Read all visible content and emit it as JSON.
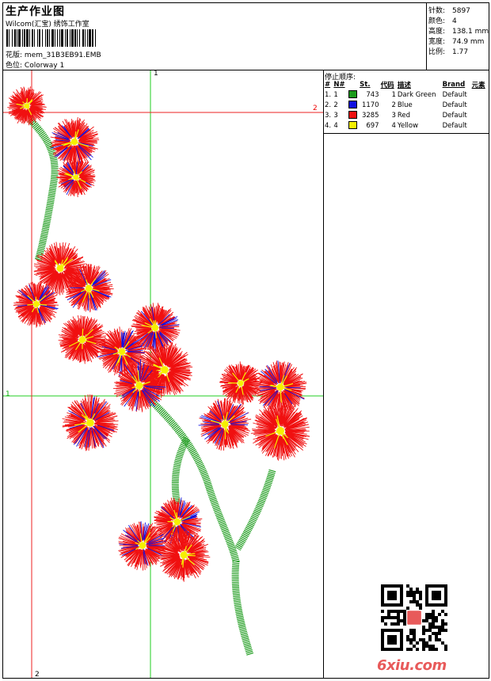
{
  "header": {
    "title": "生产作业图",
    "company": "Wilcom(汇宝) 绣饰工作室",
    "pattern_label": "花版:",
    "pattern_value": "mem_31B3EB91.EMB",
    "colorway_label": "色位:",
    "colorway_value": "Colorway 1"
  },
  "stats": [
    {
      "label": "针数:",
      "value": "5897"
    },
    {
      "label": "颜色:",
      "value": "4"
    },
    {
      "label": "高度:",
      "value": "138.1 mm"
    },
    {
      "label": "宽度:",
      "value": "74.9 mm"
    },
    {
      "label": "比例:",
      "value": "1.77"
    }
  ],
  "stop_sequence": {
    "title": "停止顺序:",
    "columns": [
      "#",
      "N#",
      "St.",
      "代码",
      "描述",
      "Brand",
      "元素"
    ],
    "rows": [
      {
        "idx": "1.",
        "n": "1",
        "color": "#1a9a1a",
        "st": "743",
        "code": "1",
        "desc": "Dark Green",
        "brand": "Default",
        "el": ""
      },
      {
        "idx": "2.",
        "n": "2",
        "color": "#1010e0",
        "st": "1170",
        "code": "2",
        "desc": "Blue",
        "brand": "Default",
        "el": ""
      },
      {
        "idx": "3.",
        "n": "3",
        "color": "#f01010",
        "st": "3285",
        "code": "3",
        "desc": "Red",
        "brand": "Default",
        "el": ""
      },
      {
        "idx": "4.",
        "n": "4",
        "color": "#f5f000",
        "st": "697",
        "code": "4",
        "desc": "Yellow",
        "brand": "Default",
        "el": ""
      }
    ]
  },
  "guides": {
    "top": "1",
    "right": "2",
    "left": "1",
    "bottom": "2"
  },
  "watermark": "6xiu.com"
}
